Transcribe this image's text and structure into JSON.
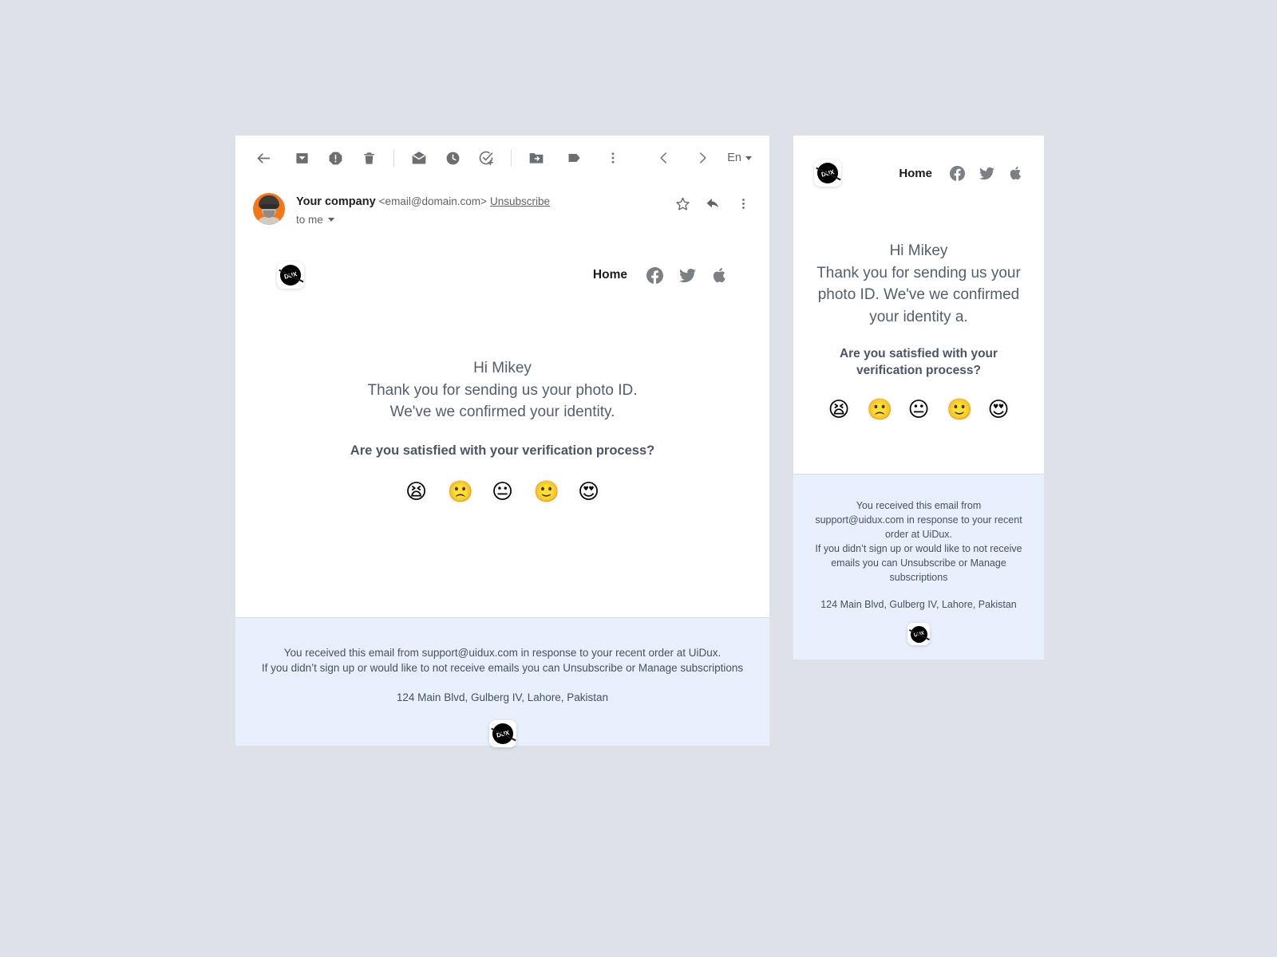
{
  "background_color": "#dfe1e8",
  "toolbar": {
    "icons": [
      {
        "name": "back-arrow-icon",
        "label": "Back"
      },
      {
        "name": "archive-icon",
        "label": "Archive"
      },
      {
        "name": "report-spam-icon",
        "label": "Report spam"
      },
      {
        "name": "delete-icon",
        "label": "Delete"
      },
      {
        "name": "mark-unread-icon",
        "label": "Mark as unread"
      },
      {
        "name": "snooze-icon",
        "label": "Snooze"
      },
      {
        "name": "add-to-tasks-icon",
        "label": "Add to tasks"
      },
      {
        "name": "move-to-icon",
        "label": "Move to"
      },
      {
        "name": "labels-icon",
        "label": "Labels"
      },
      {
        "name": "more-options-icon",
        "label": "More"
      }
    ],
    "prev_label": "Previous",
    "next_label": "Next",
    "language": "En"
  },
  "email_header": {
    "sender_name": "Your company",
    "sender_email": "<email@domain.com>",
    "unsubscribe_label": "Unsubscribe",
    "recipient": "to me",
    "actions": [
      {
        "name": "star-icon",
        "label": "Star"
      },
      {
        "name": "reply-icon",
        "label": "Reply"
      },
      {
        "name": "more-icon",
        "label": "More"
      }
    ]
  },
  "brand": {
    "logo_text": "DUX",
    "nav_home": "Home",
    "social": [
      {
        "name": "facebook-icon",
        "label": "Facebook"
      },
      {
        "name": "twitter-icon",
        "label": "Twitter"
      },
      {
        "name": "apple-icon",
        "label": "Apple"
      }
    ]
  },
  "message": {
    "greeting": "Hi Mikey",
    "line2": "Thank you for sending us your photo ID.",
    "line3": "We've we confirmed your identity.",
    "question": "Are you satisfied with your verification process?",
    "emojis": [
      {
        "name": "emoji-tired-face",
        "glyph": "😫",
        "rating": 1
      },
      {
        "name": "emoji-frowning-face",
        "glyph": "🙁",
        "rating": 2
      },
      {
        "name": "emoji-neutral-face",
        "glyph": "😐",
        "rating": 3
      },
      {
        "name": "emoji-slightly-smiling-face",
        "glyph": "🙂",
        "rating": 4
      },
      {
        "name": "emoji-heart-eyes",
        "glyph": "😍",
        "rating": 5
      }
    ]
  },
  "footer": {
    "line1": "You received this email from support@uidux.com in response to your recent order at UiDux.",
    "line2": "If you didn’t sign up or would like to not receive emails you can Unsubscribe or Manage subscriptions",
    "address": "124 Main Blvd, Gulberg IV, Lahore, Pakistan",
    "logo_text": "DUX",
    "background_color": "#e7f0fc"
  },
  "mobile": {
    "nav_home": "Home",
    "logo_text": "DUX",
    "message": {
      "greeting": "Hi Mikey",
      "line2": "Thank you for sending us your",
      "line3": "photo ID. We've we confirmed",
      "line4": "your identity a.",
      "question_line1": "Are you satisfied with your",
      "question_line2": "verification process?"
    },
    "footer": {
      "line1": "You received this email from",
      "line2": "support@uidux.com in response to your recent",
      "line3": "order at UiDux.",
      "line4": "If you didn’t sign up or would like to not receive",
      "line5": "emails you can Unsubscribe or Manage",
      "line6": "subscriptions",
      "address": "124 Main Blvd, Gulberg IV, Lahore, Pakistan",
      "logo_text": "DUX"
    }
  }
}
